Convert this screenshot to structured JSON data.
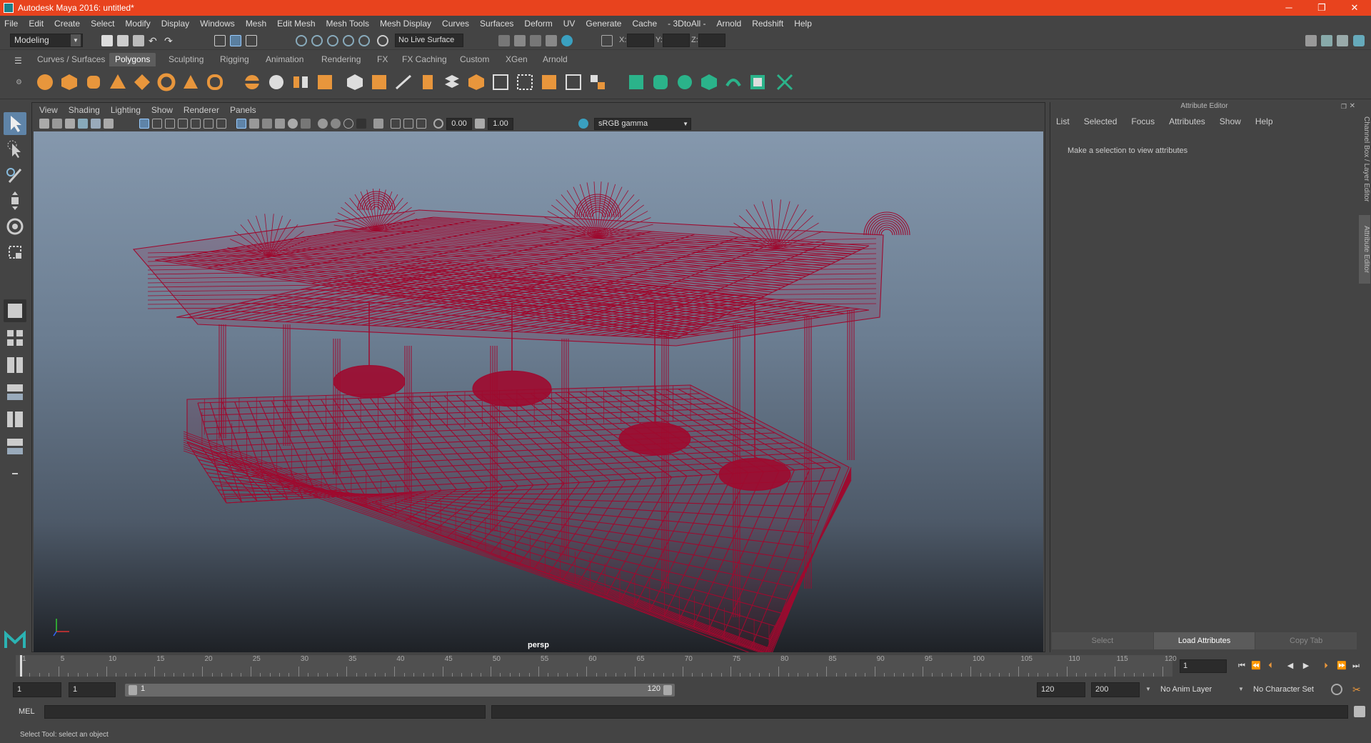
{
  "window": {
    "title": "Autodesk Maya 2016: untitled*",
    "min": "─",
    "max": "❐",
    "close": "✕"
  },
  "menubar": [
    "File",
    "Edit",
    "Create",
    "Select",
    "Modify",
    "Display",
    "Windows",
    "Mesh",
    "Edit Mesh",
    "Mesh Tools",
    "Mesh Display",
    "Curves",
    "Surfaces",
    "Deform",
    "UV",
    "Generate",
    "Cache",
    "- 3DtoAll -",
    "Arnold",
    "Redshift",
    "Help"
  ],
  "status": {
    "workspace": "Modeling",
    "live_surface": "No Live Surface",
    "x_label": "X:",
    "y_label": "Y:",
    "z_label": "Z:"
  },
  "shelf_tabs": [
    "Curves / Surfaces",
    "Polygons",
    "Sculpting",
    "Rigging",
    "Animation",
    "Rendering",
    "FX",
    "FX Caching",
    "Custom",
    "XGen",
    "Arnold"
  ],
  "shelf_active": "Polygons",
  "viewport": {
    "menu": [
      "View",
      "Shading",
      "Lighting",
      "Show",
      "Renderer",
      "Panels"
    ],
    "exposure": "0.00",
    "gamma": "1.00",
    "colorspace": "sRGB gamma",
    "camera": "persp",
    "wire_color": "#9e0a2f"
  },
  "attribute_editor": {
    "title": "Attribute Editor",
    "menu": [
      "List",
      "Selected",
      "Focus",
      "Attributes",
      "Show",
      "Help"
    ],
    "message": "Make a selection to view attributes",
    "buttons": [
      "Select",
      "Load Attributes",
      "Copy Tab"
    ]
  },
  "side_tabs": [
    "Channel Box / Layer Editor",
    "Attribute Editor"
  ],
  "timeline": {
    "ticks": [
      "1",
      "5",
      "10",
      "15",
      "20",
      "25",
      "30",
      "35",
      "40",
      "45",
      "50",
      "55",
      "60",
      "65",
      "70",
      "75",
      "80",
      "85",
      "90",
      "95",
      "100",
      "105",
      "110",
      "115",
      "120"
    ],
    "current_frame": "1"
  },
  "range": {
    "start": "1",
    "playback_start": "1",
    "slider_start": "1",
    "slider_end": "120",
    "playback_end": "120",
    "end": "200",
    "anim_layer": "No Anim Layer",
    "char_set": "No Character Set"
  },
  "mel": {
    "label": "MEL"
  },
  "help_line": "Select Tool: select an object"
}
